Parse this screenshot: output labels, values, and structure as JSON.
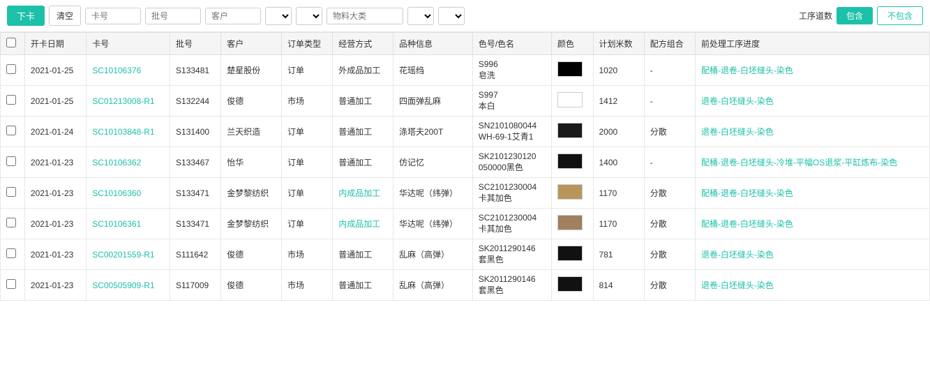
{
  "toolbar": {
    "btn_download": "下卡",
    "btn_clear": "清空",
    "input_card_placeholder": "卡号",
    "input_batch_placeholder": "批号",
    "input_customer_placeholder": "客户",
    "select_type1_options": [
      ""
    ],
    "select_type2_options": [
      ""
    ],
    "input_material_placeholder": "物料大类",
    "select_type3_options": [
      ""
    ],
    "select_type4_options": [
      ""
    ],
    "label_process_count": "工序道数",
    "btn_include": "包含",
    "btn_exclude": "不包含"
  },
  "table": {
    "headers": [
      "",
      "开卡日期",
      "卡号",
      "批号",
      "客户",
      "订单类型",
      "经营方式",
      "品种信息",
      "色号/色名",
      "颜色",
      "计划米数",
      "配方组合",
      "前处理工序进度"
    ],
    "rows": [
      {
        "checked": false,
        "date": "2021-01-25",
        "card_no": "SC10106376",
        "batch": "S133481",
        "customer": "楚星股份",
        "order_type": "订单",
        "operation": "外成品加工",
        "variety": "花瑶绉",
        "color_code": "S996\n皂洗",
        "color_hex": "#000000",
        "planned_meters": "1020",
        "formula": "-",
        "process": "配桶-退卷-白坯缝头-染色",
        "process_is_link": true
      },
      {
        "checked": false,
        "date": "2021-01-25",
        "card_no": "SC01213008-R1",
        "batch": "S132244",
        "customer": "俊德",
        "order_type": "市场",
        "operation": "普通加工",
        "variety": "四面弹乱麻",
        "color_code": "S997\n本白",
        "color_hex": "#ffffff",
        "planned_meters": "1412",
        "formula": "-",
        "process": "退卷-白坯缝头-染色",
        "process_is_link": true
      },
      {
        "checked": false,
        "date": "2021-01-24",
        "card_no": "SC10103848-R1",
        "batch": "S131400",
        "customer": "兰天织造",
        "order_type": "订单",
        "operation": "普通加工",
        "variety": "涤塔夫200T",
        "color_code": "SN2101080044\nWH-69-1艾青1",
        "color_hex": "#1a1a1a",
        "planned_meters": "2000",
        "formula": "分散",
        "process": "退卷-白坯缝头-染色",
        "process_is_link": true
      },
      {
        "checked": false,
        "date": "2021-01-23",
        "card_no": "SC10106362",
        "batch": "S133467",
        "customer": "怡华",
        "order_type": "订单",
        "operation": "普通加工",
        "variety": "仿记忆",
        "color_code": "SK2101230120\n050000黑色",
        "color_hex": "#111111",
        "planned_meters": "1400",
        "formula": "-",
        "process": "配桶-退卷-白坯缝头-冷堆-平幅OS退浆-平缸炼布-染色",
        "process_is_link": true
      },
      {
        "checked": false,
        "date": "2021-01-23",
        "card_no": "SC10106360",
        "batch": "S133471",
        "customer": "金梦黎纺织",
        "order_type": "订单",
        "operation": "内成品加工",
        "variety": "华达呢（纬弹）",
        "color_code": "SC2101230004\n卡其加色",
        "color_hex": "#b8955a",
        "planned_meters": "1170",
        "formula": "分散",
        "process": "配桶-退卷-白坯缝头-染色",
        "process_is_link": true
      },
      {
        "checked": false,
        "date": "2021-01-23",
        "card_no": "SC10106361",
        "batch": "S133471",
        "customer": "金梦黎纺织",
        "order_type": "订单",
        "operation": "内成品加工",
        "variety": "华达呢（纬弹）",
        "color_code": "SC2101230004\n卡其加色",
        "color_hex": "#a08060",
        "planned_meters": "1170",
        "formula": "分散",
        "process": "配桶-退卷-白坯缝头-染色",
        "process_is_link": true
      },
      {
        "checked": false,
        "date": "2021-01-23",
        "card_no": "SC00201559-R1",
        "batch": "S111642",
        "customer": "俊德",
        "order_type": "市场",
        "operation": "普通加工",
        "variety": "乱麻（高弹）",
        "color_code": "SK2011290146\n套黑色",
        "color_hex": "#111111",
        "planned_meters": "781",
        "formula": "分散",
        "process": "退卷-白坯缝头-染色",
        "process_is_link": true
      },
      {
        "checked": false,
        "date": "2021-01-23",
        "card_no": "SC00505909-R1",
        "batch": "S117009",
        "customer": "俊德",
        "order_type": "市场",
        "operation": "普通加工",
        "variety": "乱麻（高弹）",
        "color_code": "SK2011290146\n套黑色",
        "color_hex": "#111111",
        "planned_meters": "814",
        "formula": "分散",
        "process": "退卷-白坯缝头-染色",
        "process_is_link": true
      }
    ]
  }
}
